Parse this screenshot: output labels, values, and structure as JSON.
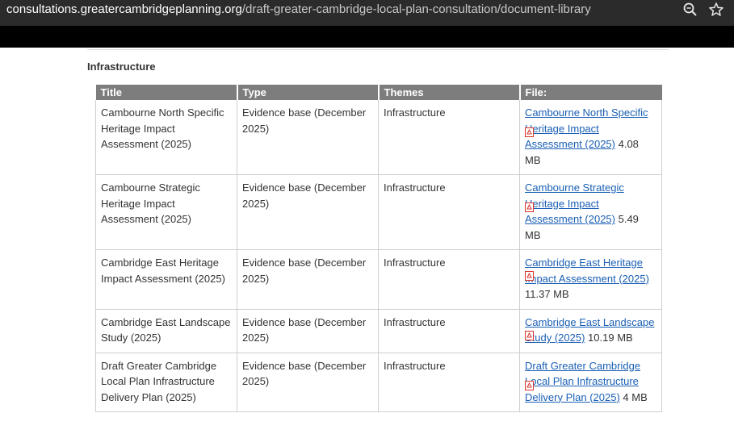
{
  "browser": {
    "url_host": "consultations.greatercambridgeplanning.org",
    "url_path": "/draft-greater-cambridge-local-plan-consultation/document-library",
    "icons": [
      "zoom-icon",
      "star-icon"
    ]
  },
  "section": {
    "title": "Infrastructure"
  },
  "table": {
    "headers": [
      "Title",
      "Type",
      "Themes",
      "File:"
    ],
    "rows": [
      {
        "title": "Cambourne North Specific Heritage Impact Assessment (2025)",
        "type": "Evidence base (December 2025)",
        "themes": "Infrastructure",
        "file_link": "Cambourne North Specific Heritage Impact Assessment (2025)",
        "file_size": " 4.08 MB"
      },
      {
        "title": "Cambourne Strategic Heritage Impact Assessment (2025)",
        "type": "Evidence base (December 2025)",
        "themes": "Infrastructure",
        "file_link": "Cambourne Strategic Heritage Impact Assessment (2025)",
        "file_size": " 5.49 MB"
      },
      {
        "title": "Cambridge East Heritage Impact Assessment (2025)",
        "type": "Evidence base (December 2025)",
        "themes": "Infrastructure",
        "file_link": "Cambridge East Heritage Impact Assessment (2025)",
        "file_size": " 11.37 MB"
      },
      {
        "title": "Cambridge East Landscape Study (2025)",
        "type": "Evidence base (December 2025)",
        "themes": "Infrastructure",
        "file_link": "Cambridge East Landscape Study (2025)",
        "file_size": " 10.19 MB"
      },
      {
        "title": "Draft Greater Cambridge Local Plan Infrastructure Delivery Plan (2025)",
        "type": "Evidence base (December 2025)",
        "themes": "Infrastructure",
        "file_link": "Draft Greater Cambridge Local Plan Infrastructure Delivery Plan (2025)",
        "file_size": " 4 MB"
      }
    ]
  },
  "colors": {
    "header_bg": "#7d7d7d",
    "link": "#1a5fb4",
    "pdf_icon": "#d9342b"
  }
}
